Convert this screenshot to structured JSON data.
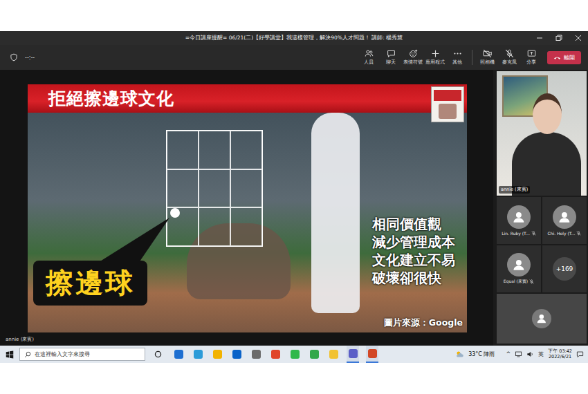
{
  "window": {
    "title": "=今日講座提醒= 06/21(二)【好學講堂】我這樣管理，解決90%人才問題！ 講師: 楊秀慧"
  },
  "toolbar": {
    "timer": "--:--",
    "actions": [
      {
        "label": "人員",
        "kind": "people"
      },
      {
        "label": "聊天",
        "kind": "chat"
      },
      {
        "label": "表情符號",
        "kind": "react"
      },
      {
        "label": "應用程式",
        "kind": "apps"
      },
      {
        "label": "其他",
        "kind": "more"
      }
    ],
    "devices": [
      {
        "label": "照相機",
        "kind": "camera",
        "on": false
      },
      {
        "label": "麥克風",
        "kind": "mic",
        "on": false
      },
      {
        "label": "分享",
        "kind": "share",
        "on": false
      }
    ],
    "leave": "離開"
  },
  "stage": {
    "slide": {
      "title": "拒絕擦邊球文化",
      "callout": "擦邊球",
      "points": [
        "相同價值觀",
        "減少管理成本",
        "文化建立不易",
        "破壞卻很快"
      ],
      "credit": "圖片來源：Google"
    },
    "presenter": "annie (來賓)"
  },
  "roster": {
    "speaker": "annie (來賓)",
    "tiles": [
      {
        "name": "Lin. Ruby (T...",
        "muted": true
      },
      {
        "name": "Chi. Holy (T...",
        "muted": true
      },
      {
        "name": "Equal (來賓)",
        "muted": true
      }
    ],
    "more": "+169"
  },
  "taskbar": {
    "search": {
      "placeholder": "在這裡輸入文字來搜尋"
    },
    "apps": [
      {
        "running": false
      },
      {
        "running": false
      },
      {
        "running": false
      },
      {
        "running": false
      },
      {
        "running": false
      },
      {
        "running": false
      },
      {
        "running": false
      },
      {
        "running": false
      },
      {
        "running": false
      },
      {
        "running": true
      },
      {
        "running": true
      }
    ],
    "weather": {
      "temp": "33°C",
      "text": "陣雨"
    },
    "tray_arrow": "^",
    "ime": "英",
    "time": "下午 03:42",
    "date": "2022/6/21"
  }
}
